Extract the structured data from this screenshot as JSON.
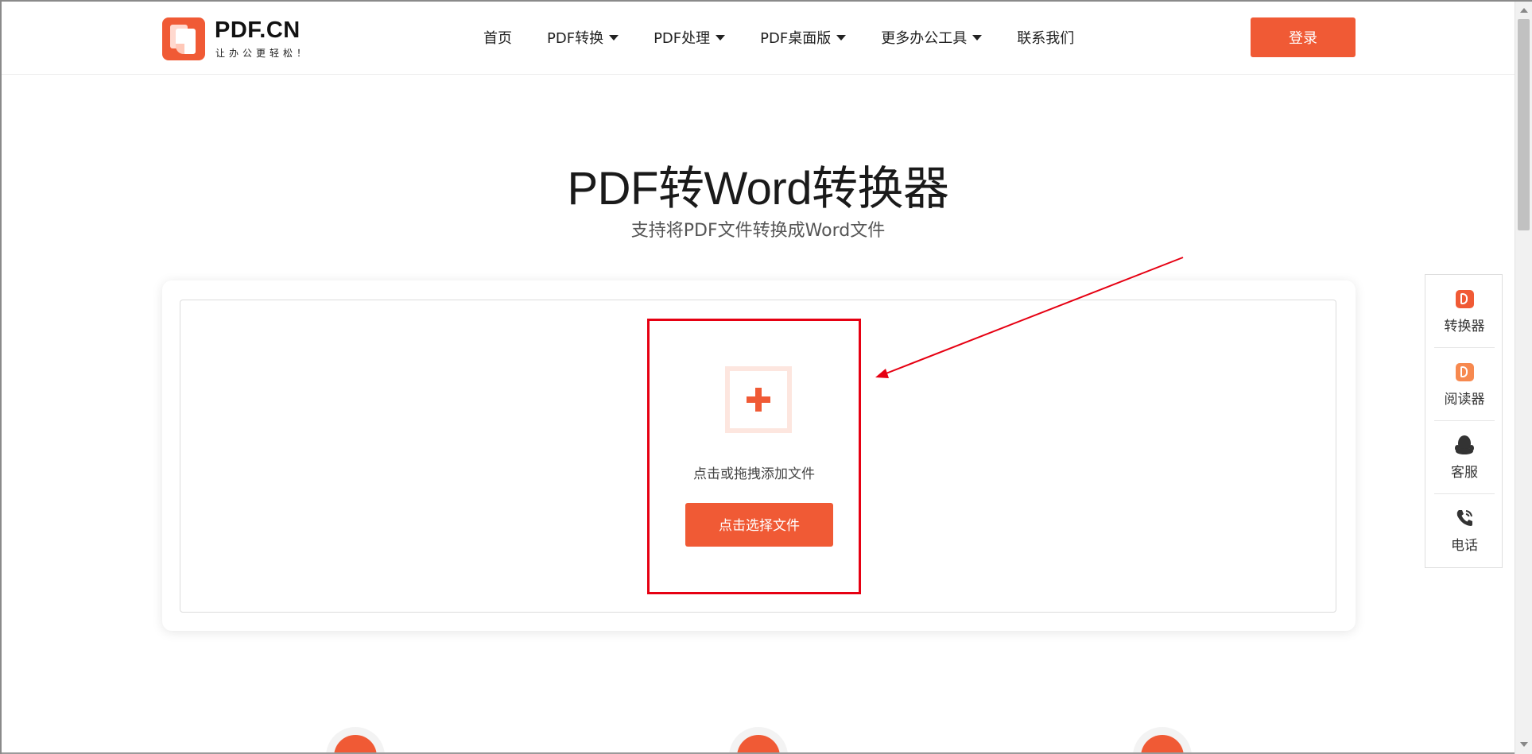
{
  "brand": {
    "name": "PDF.CN",
    "tagline": "让办公更轻松！",
    "accent_color": "#f05a35"
  },
  "nav": {
    "items": [
      {
        "label": "首页",
        "has_dropdown": false
      },
      {
        "label": "PDF转换",
        "has_dropdown": true
      },
      {
        "label": "PDF处理",
        "has_dropdown": true
      },
      {
        "label": "PDF桌面版",
        "has_dropdown": true
      },
      {
        "label": "更多办公工具",
        "has_dropdown": true
      },
      {
        "label": "联系我们",
        "has_dropdown": false
      }
    ],
    "login_label": "登录"
  },
  "hero": {
    "title": "PDF转Word转换器",
    "subtitle": "支持将PDF文件转换成Word文件"
  },
  "upload": {
    "hint": "点击或拖拽添加文件",
    "button_label": "点击选择文件",
    "add_icon": "plus-icon"
  },
  "annotation": {
    "highlight_color": "#e60012",
    "arrow_color": "#e60012"
  },
  "side_toolbar": {
    "items": [
      {
        "label": "转换器",
        "icon": "converter-app-icon"
      },
      {
        "label": "阅读器",
        "icon": "reader-app-icon"
      },
      {
        "label": "客服",
        "icon": "qq-icon"
      },
      {
        "label": "电话",
        "icon": "phone-icon"
      }
    ]
  }
}
